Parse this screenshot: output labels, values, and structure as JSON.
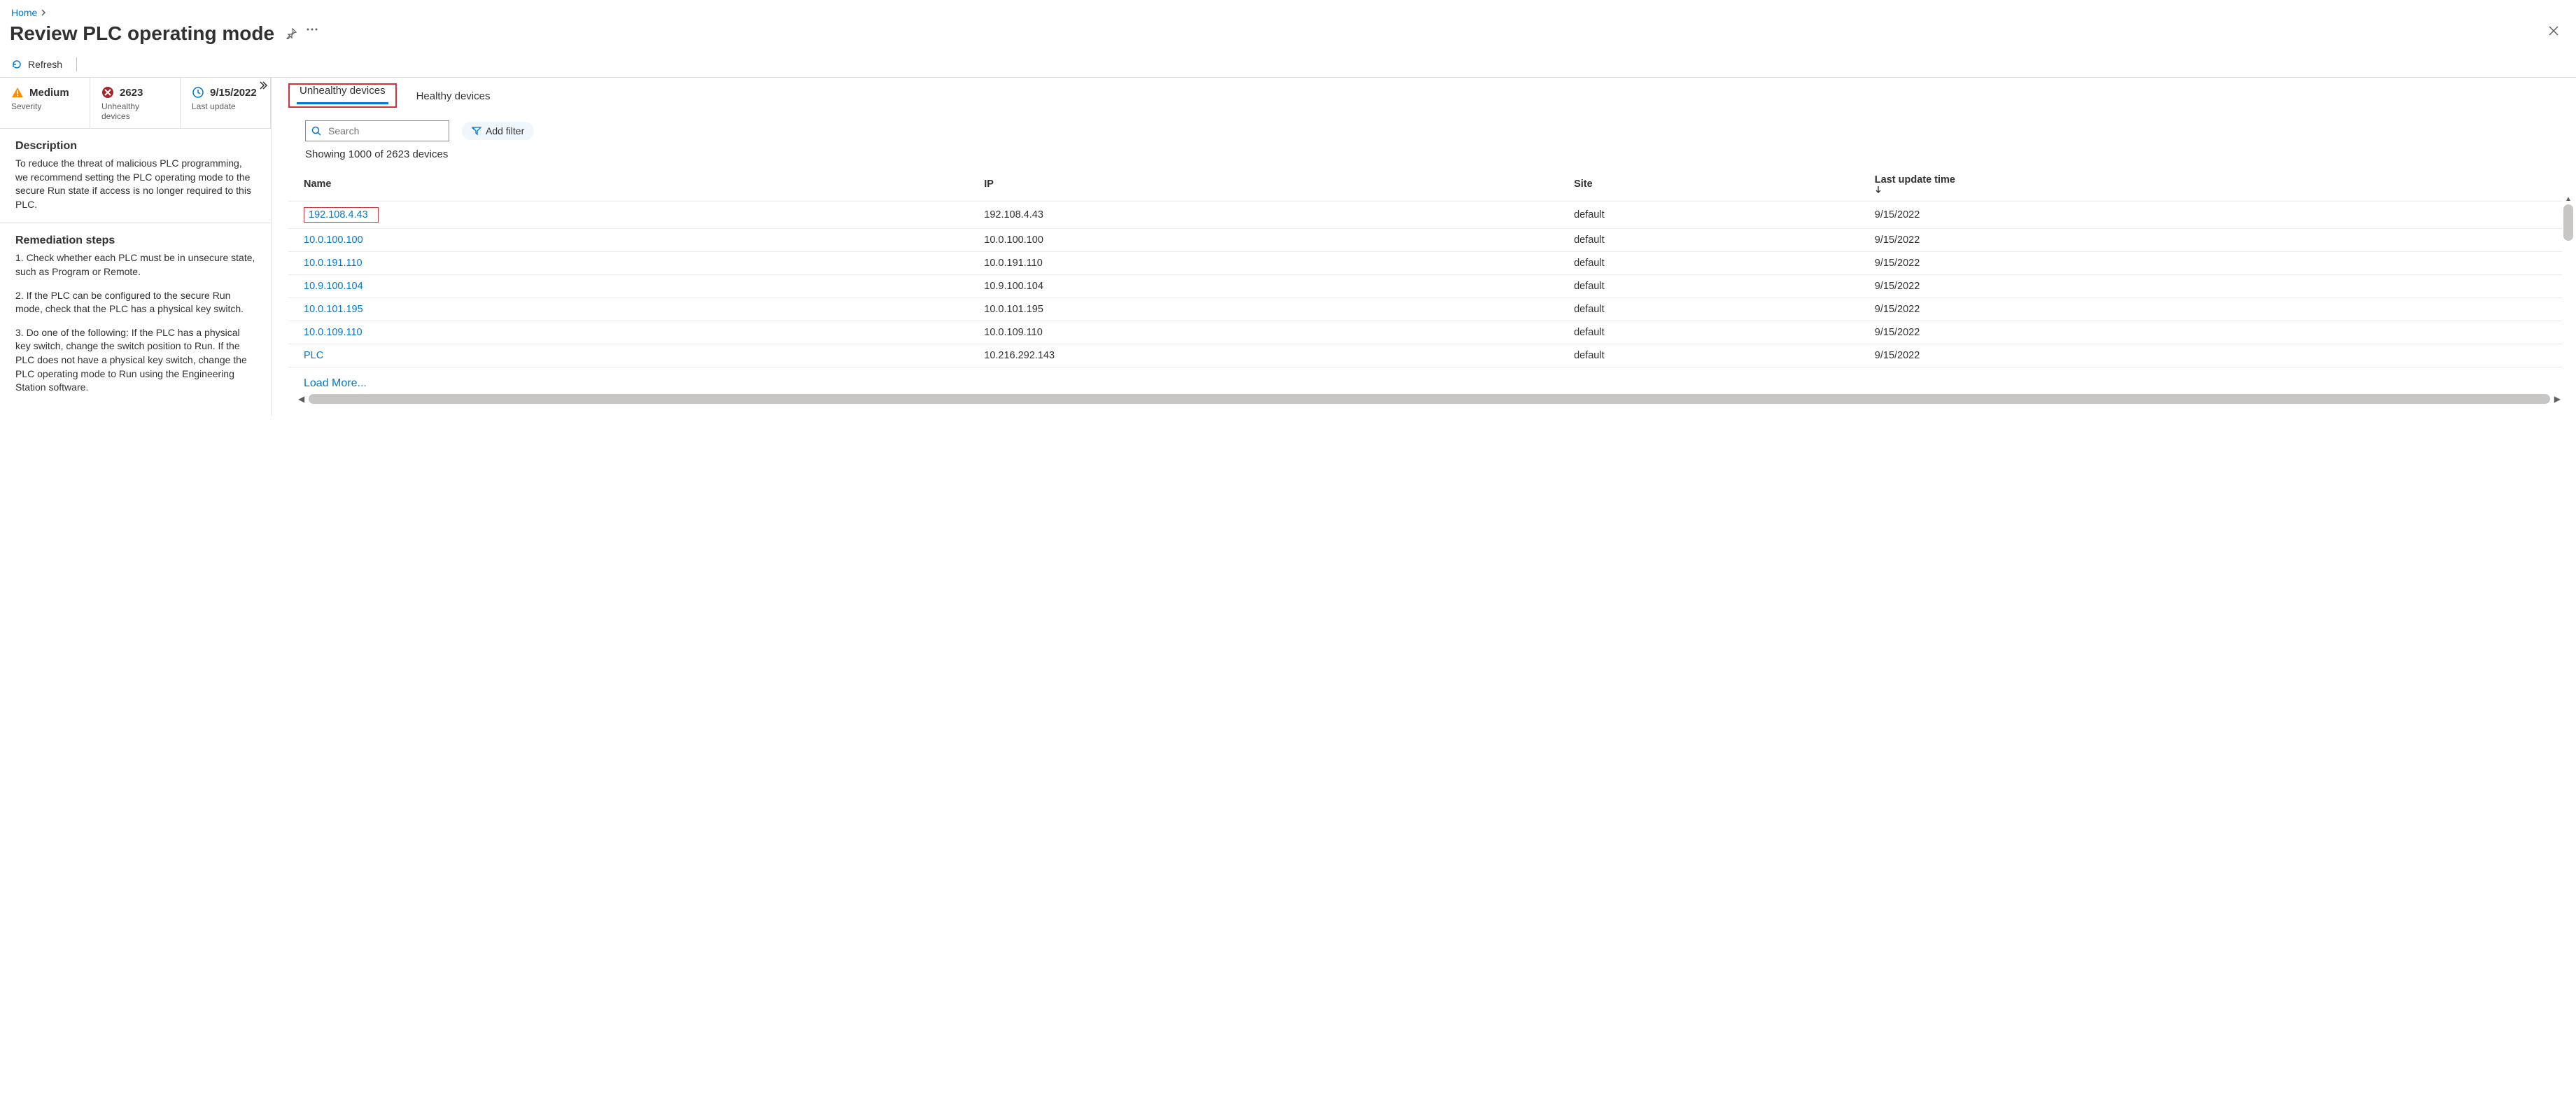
{
  "breadcrumb": {
    "home": "Home"
  },
  "page": {
    "title": "Review PLC operating mode",
    "refresh": "Refresh"
  },
  "kpi": {
    "severity": {
      "value": "Medium",
      "label": "Severity"
    },
    "unhealthy": {
      "value": "2623",
      "label": "Unhealthy devices"
    },
    "last_update": {
      "value": "9/15/2022",
      "label": "Last update"
    }
  },
  "description": {
    "heading": "Description",
    "body": "To reduce the threat of malicious PLC programming, we recommend setting the PLC operating mode to the secure Run state if access is no longer required to this PLC."
  },
  "remediation": {
    "heading": "Remediation steps",
    "s1": "1. Check whether each PLC must be in unsecure state, such as Program or Remote.",
    "s2": "2. If the PLC can be configured to the secure Run mode, check that the PLC has a physical key switch.",
    "s3": "3. Do one of the following: If the PLC has a physical key switch, change the switch position to Run. If the PLC does not have a physical key switch, change the PLC operating mode to Run using the Engineering Station software."
  },
  "tabs": {
    "unhealthy": "Unhealthy devices",
    "healthy": "Healthy devices"
  },
  "filters": {
    "search_placeholder": "Search",
    "add_filter": "Add filter",
    "showing": "Showing 1000 of 2623 devices"
  },
  "table": {
    "headers": {
      "name": "Name",
      "ip": "IP",
      "site": "Site",
      "last_update": "Last update time"
    },
    "rows": [
      {
        "name": "192.108.4.43",
        "ip": "192.108.4.43",
        "site": "default",
        "time": "9/15/2022",
        "hl": true
      },
      {
        "name": "10.0.100.100",
        "ip": "10.0.100.100",
        "site": "default",
        "time": "9/15/2022"
      },
      {
        "name": "10.0.191.110",
        "ip": "10.0.191.110",
        "site": "default",
        "time": "9/15/2022"
      },
      {
        "name": "10.9.100.104",
        "ip": "10.9.100.104",
        "site": "default",
        "time": "9/15/2022"
      },
      {
        "name": "10.0.101.195",
        "ip": "10.0.101.195",
        "site": "default",
        "time": "9/15/2022"
      },
      {
        "name": "10.0.109.110",
        "ip": "10.0.109.110",
        "site": "default",
        "time": "9/15/2022"
      },
      {
        "name": "PLC",
        "ip": "10.216.292.143",
        "site": "default",
        "time": "9/15/2022"
      }
    ],
    "load_more": "Load More..."
  }
}
